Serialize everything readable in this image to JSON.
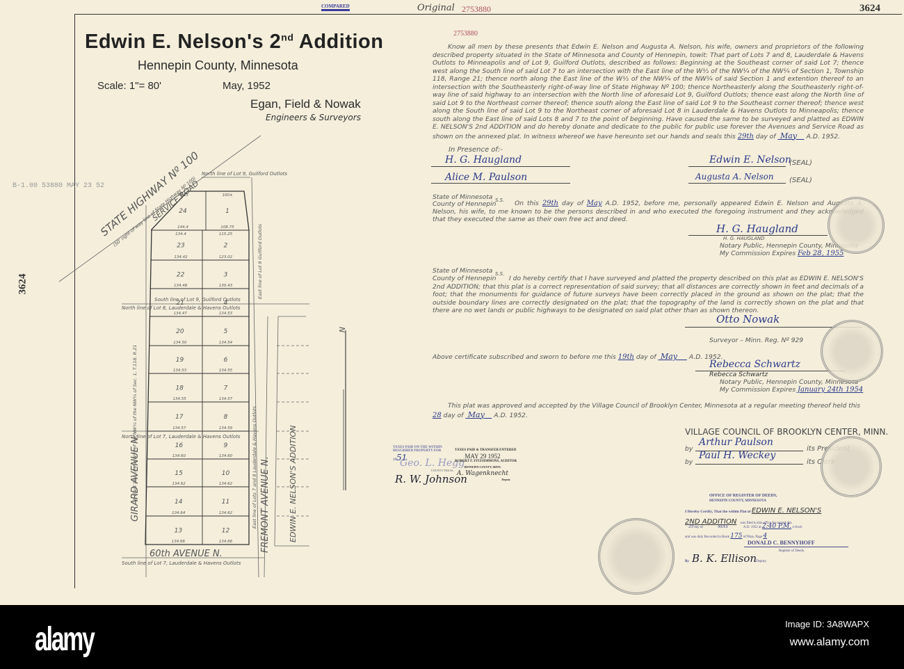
{
  "header": {
    "compared_stamp": "COMPARED",
    "original_label": "Original",
    "doc_number": "2753880",
    "sheet_number": "3624"
  },
  "margin": {
    "file_stamp": "B-1.00  53880  MAY 23 52",
    "sheet_number_vertical": "3624"
  },
  "title": {
    "main": "Edwin E. Nelson's 2",
    "main_sup": "nd",
    "main_end": " Addition",
    "county": "Hennepin County, Minnesota",
    "scale": "Scale: 1\"= 80'",
    "date": "May, 1952",
    "firm": "Egan, Field & Nowak",
    "firm_sub": "Engineers & Surveyors"
  },
  "plat": {
    "highway": "STATE HIGHWAY Nº 100",
    "highway_row": "(50' right-of-way line of State Highway Nº 100)",
    "service_road": "SERVICE ROAD",
    "girard": "GIRARD AVENUE N.",
    "fremont": "FREMONT AVENUE N.",
    "avenue_60": "60th AVENUE N.",
    "adjacent": "EDWIN E. NELSON'S ADDITION",
    "notes": {
      "north_lot9": "North line of Lot 9, Guilford Outlots",
      "south_lot9": "South line of Lot 9, Guilford Outlots",
      "north_lot8": "North line of Lot 8, Lauderdale & Havens Outlots",
      "north_lot7": "North line of Lot 7, Lauderdale & Havens Outlots",
      "south_lot7": "South line of Lot 7, Lauderdale & Havens Outlots",
      "east_lot9": "East line of Lot 9 Guilford Outlots",
      "east_lots78": "East line of Lots 7 and 8 Lauderdale & Havens Outlots",
      "east_w_half": "E. East line of the W½ of the NW¼ of the NW¼ of Sec. 1, T.118, R.21"
    },
    "lots_left": [
      {
        "n": "24",
        "top": "46.25",
        "bottom": "144.4"
      },
      {
        "n": "23",
        "top": "134.4",
        "bottom": "134.42"
      },
      {
        "n": "22",
        "top": "",
        "bottom": "134.48"
      },
      {
        "n": "21",
        "top": "",
        "bottom": "134.47"
      },
      {
        "n": "20",
        "top": "",
        "bottom": "134.50"
      },
      {
        "n": "19",
        "top": "",
        "bottom": "134.53"
      },
      {
        "n": "18",
        "top": "",
        "bottom": "134.55"
      },
      {
        "n": "17",
        "top": "",
        "bottom": "134.57"
      },
      {
        "n": "16",
        "top": "",
        "bottom": "134.60"
      },
      {
        "n": "15",
        "top": "",
        "bottom": "134.62"
      },
      {
        "n": "14",
        "top": "",
        "bottom": "134.64"
      },
      {
        "n": "13",
        "top": "",
        "bottom": "134.66"
      }
    ],
    "lots_right": [
      {
        "n": "1",
        "top": "100±",
        "bottom": "108.75"
      },
      {
        "n": "2",
        "top": "115.25",
        "bottom": "123.02"
      },
      {
        "n": "3",
        "top": "",
        "bottom": "130.43"
      },
      {
        "n": "4",
        "top": "",
        "bottom": "134.53"
      },
      {
        "n": "5",
        "top": "",
        "bottom": "134.54"
      },
      {
        "n": "6",
        "top": "",
        "bottom": "134.55"
      },
      {
        "n": "7",
        "top": "",
        "bottom": "134.57"
      },
      {
        "n": "8",
        "top": "",
        "bottom": "134.59"
      },
      {
        "n": "9",
        "top": "",
        "bottom": "134.60"
      },
      {
        "n": "10",
        "top": "",
        "bottom": "134.62"
      },
      {
        "n": "11",
        "top": "",
        "bottom": "134.62"
      },
      {
        "n": "12",
        "top": "",
        "bottom": "134.66"
      }
    ],
    "north_arrow": "N"
  },
  "dedication": {
    "doc_number": "2753880",
    "text": "Know all men by these presents that Edwin E. Nelson and Augusta A. Nelson, his wife, owners and proprietors of the following described property situated in the State of Minnesota and County of Hennepin, towit: That part of Lots 7 and 8, Lauderdale & Havens Outlots to Minneapolis and of Lot 9, Guilford Outlots, described as follows: Beginning at the Southeast corner of said Lot 7; thence west along the South line of said Lot 7 to an intersection with the East line of the W½ of the NW¼ of the NW¼ of Section 1, Township 118, Range 21; thence north along the East line of the W½ of the NW¼ of the NW¼ of said Section 1 and extention thereof to an intersection with the Southeasterly right-of-way line of State Highway Nº 100; thence Northeasterly along the Southeasterly right-of-way line of said highway to an intersection with the North line of aforesaid Lot 9, Guilford Outlots; thence east along the North line of said Lot 9 to the Northeast corner thereof; thence south along the East line of said Lot 9 to the Southeast corner thereof; thence west along the South line of said Lot 9 to the Northeast corner of aforesaid Lot 8 in Lauderdale & Havens Outlots to Minneapolis; thence south along the East line of said Lots 8 and 7 to the point of beginning. Have caused the same to be surveyed and platted as EDWIN E. NELSON'S 2nd ADDITION and do hereby donate and dedicate to the public for public use forever the Avenues and Service Road as shown on the annexed plat. In witness whereof we have hereunto set our hands and seals this",
    "day": "29th",
    "day_of": "day of",
    "month": "May",
    "year": "A.D. 1952.",
    "presence": "In Presence of:-",
    "witness1": "H. G. Haugland",
    "witness2": "Alice M. Paulson",
    "owner1": "Edwin E. Nelson",
    "owner2": "Augusta A. Nelson",
    "seal": "(SEAL)"
  },
  "acknowledgment": {
    "state": "State of Minnesota",
    "county": "County of Hennepin",
    "ss": "S.S.",
    "text_a": "On this",
    "day": "29th",
    "text_b": "day of",
    "month": "May",
    "text_c": "A.D. 1952, before me, personally appeared Edwin E. Nelson and Augusta A. Nelson, his wife, to me known to be the persons described in and who executed the foregoing instrument and they acknowledged that they executed the same as their own free act and deed.",
    "signature": "H. G. Haugland",
    "printed": "H. G. HAUGLAND",
    "notary": "Notary Public, Hennepin County, Minnesota",
    "expires_label": "My Commission Expires",
    "expires": "Feb 28, 1955"
  },
  "surveyor": {
    "state": "State of Minnesota",
    "county": "County of Hennepin",
    "ss": "S.S.",
    "text": "I do hereby certify that I have surveyed and platted the property described on this plat as EDWIN E. NELSON'S 2nd ADDITION; that this plat is a correct representation of said survey; that all distances are correctly shown in feet and decimals of a foot; that the monuments for guidance of future surveys have been correctly placed in the ground as shown on the plat; that the outside boundary lines are correctly designated on the plat; that the topography of the land is correctly shown on the plat and that there are no wet lands or public highways to be designated on said plat other than as shown thereon.",
    "signature": "Otto Nowak",
    "title": "Surveyor – Minn. Reg. Nº 929",
    "sworn_a": "Above certificate subscribed and sworn to before me this",
    "sworn_day": "19th",
    "sworn_b": "day of",
    "sworn_month": "May",
    "sworn_year": "A.D. 1952.",
    "notary_sig": "Rebecca Schwartz",
    "notary_printed": "Rebecca Schwartz",
    "notary": "Notary Public, Hennepin County, Minnesota",
    "expires_label": "My Commission Expires",
    "expires": "January 24th 1954"
  },
  "approval": {
    "text": "This plat was approved and accepted by the Village Council of Brooklyn Center, Minnesota at a regular meeting thereof held this",
    "day": "28",
    "day_of": "day of",
    "month": "May",
    "year": "A.D. 1952.",
    "council": "VILLAGE COUNCIL OF BROOKLYN CENTER, MINN.",
    "by": "by",
    "president_sig": "Arthur Paulson",
    "president": "its President",
    "clerk_sig": "Paul H. Weckey",
    "clerk": "its Clerk"
  },
  "taxes": {
    "stamp1": "TAXES PAID ON THE WITHIN DESCRIBED PROPERTY FOR 19",
    "year": "51",
    "sig1": "Geo. L. Hegg",
    "county_treas": "COUNTY TREAS.",
    "sig2": "R. W. Johnson",
    "stamp2_title": "TAXES PAID & TRANSFER ENTERED",
    "stamp2_date": "MAY 29 1952",
    "stamp2_auditor": "ROBERT F. FITZSIMMONS, AUDITOR",
    "stamp2_county": "HENNEPIN COUNTY, MINN.",
    "stamp2_sig": "A. Wagenknecht",
    "deputy": "Deputy"
  },
  "register": {
    "office": "OFFICE OF REGISTER OF DEEDS,",
    "county": "HENNEPIN COUNTY, MINNESOTA",
    "certify": "I Hereby Certify, That the within Plat of",
    "plat_name": "EDWIN E. NELSON'S",
    "plat_name2": "2ND ADDITION",
    "filed": "was filed in this office for record this",
    "day": "29",
    "day_of": "day of",
    "month": "MAY",
    "ad": "A.D. 1952 at",
    "time": "2:40 P.M.",
    "oclock": "o'clock",
    "recorded": "and was duly Recorded in Book",
    "book": "175",
    "of_plats": "of Plats, Page",
    "page": "4",
    "registrar": "DONALD C. BENNYHOFF",
    "registrar_title": "Register of Deeds.",
    "by": "By",
    "deputy_sig": "B. K. Ellison",
    "deputy": "Deputy."
  },
  "footer": {
    "logo": "alamy",
    "image_id": "Image ID: 3A8WAPX",
    "url": "www.alamy.com"
  }
}
